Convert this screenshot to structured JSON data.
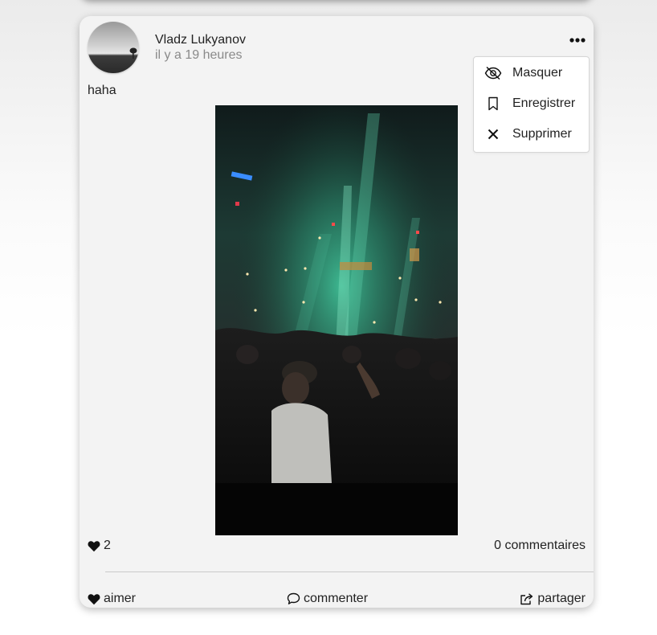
{
  "post": {
    "author": "Vladz Lukyanov",
    "time": "il y a 19 heures",
    "text": "haha",
    "likes": "2",
    "comments": "0 commentaires"
  },
  "actions": {
    "like": "aimer",
    "comment": "commenter",
    "share": "partager"
  },
  "menu": {
    "items": [
      {
        "label": "Masquer",
        "icon": "eye-off-icon"
      },
      {
        "label": "Enregistrer",
        "icon": "bookmark-icon"
      },
      {
        "label": "Supprimer",
        "icon": "close-icon"
      }
    ]
  },
  "icons": {
    "more": "more-horizontal-icon",
    "heart": "heart-icon",
    "comment": "comment-icon",
    "share": "share-icon"
  },
  "colors": {
    "card_background": "#f3f3f3",
    "text": "#222222",
    "muted_text": "#8a8a8a",
    "divider": "#c9c9c9"
  }
}
